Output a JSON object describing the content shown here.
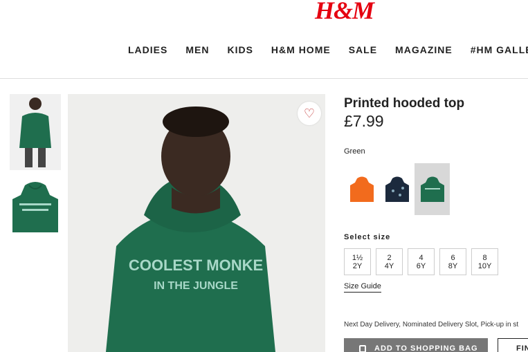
{
  "header": {
    "logo": "H&M",
    "nav": [
      "LADIES",
      "MEN",
      "KIDS",
      "H&M HOME",
      "SALE",
      "MAGAZINE",
      "#HM GALLE"
    ]
  },
  "product": {
    "title": "Printed hooded top",
    "price": "£7.99",
    "color_label": "Green",
    "garment_print_line1": "COOLEST MONKE",
    "garment_print_line2": "IN THE JUNGLE",
    "swatches": [
      {
        "color": "#f26b1d",
        "selected": false
      },
      {
        "color": "#1c2a3d",
        "selected": false
      },
      {
        "color": "#1f6e4e",
        "selected": true
      }
    ],
    "size_label": "Select size",
    "sizes": [
      {
        "top": "1½",
        "bottom": "2Y"
      },
      {
        "top": "2",
        "bottom": "4Y"
      },
      {
        "top": "4",
        "bottom": "6Y"
      },
      {
        "top": "6",
        "bottom": "8Y"
      },
      {
        "top": "8",
        "bottom": "10Y"
      }
    ],
    "size_guide": "Size Guide",
    "delivery": "Next Day Delivery, Nominated Delivery Slot, Pick-up in st",
    "add_to_bag": "ADD TO SHOPPING BAG",
    "find_in_store": "FIN"
  },
  "colors": {
    "brand": "#e50010",
    "hoodie": "#1f6e4e",
    "print": "#a8d8c8"
  }
}
